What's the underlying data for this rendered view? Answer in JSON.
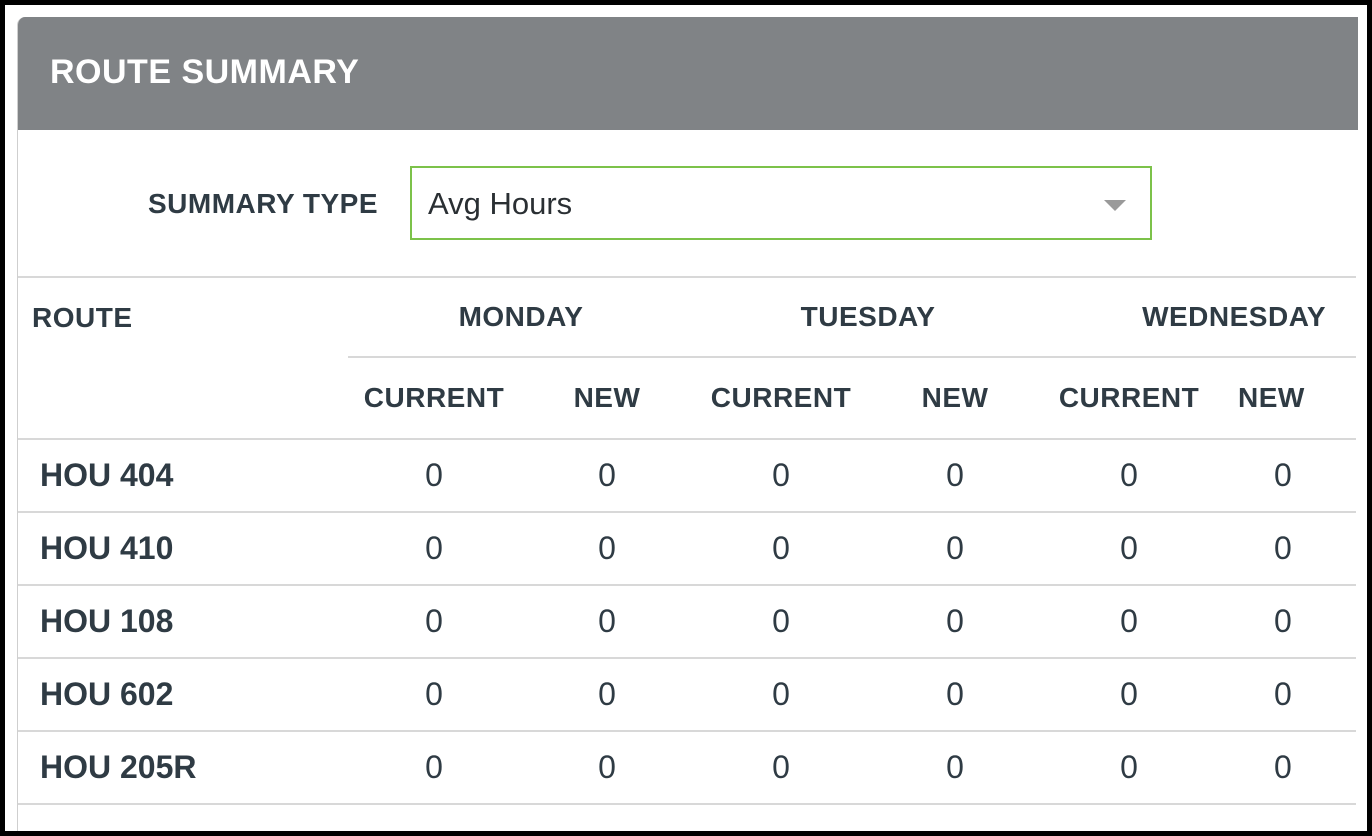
{
  "panel": {
    "title": "ROUTE SUMMARY"
  },
  "filter": {
    "label": "SUMMARY TYPE",
    "selected": "Avg Hours",
    "caret_icon": "chevron-down-icon"
  },
  "table": {
    "route_header": "ROUTE",
    "days": [
      "MONDAY",
      "TUESDAY",
      "WEDNESDAY"
    ],
    "sub_headers": [
      "CURRENT",
      "NEW",
      "CURRENT",
      "NEW",
      "CURRENT",
      "NEW"
    ],
    "rows": [
      {
        "route": "HOU 404",
        "values": [
          "0",
          "0",
          "0",
          "0",
          "0",
          "0"
        ]
      },
      {
        "route": "HOU 410",
        "values": [
          "0",
          "0",
          "0",
          "0",
          "0",
          "0"
        ]
      },
      {
        "route": "HOU 108",
        "values": [
          "0",
          "0",
          "0",
          "0",
          "0",
          "0"
        ]
      },
      {
        "route": "HOU 602",
        "values": [
          "0",
          "0",
          "0",
          "0",
          "0",
          "0"
        ]
      },
      {
        "route": "HOU 205R",
        "values": [
          "0",
          "0",
          "0",
          "0",
          "0",
          "0"
        ]
      }
    ]
  },
  "colors": {
    "header_bg": "#808386",
    "select_border": "#7cc24a",
    "text": "#2f3b44"
  }
}
